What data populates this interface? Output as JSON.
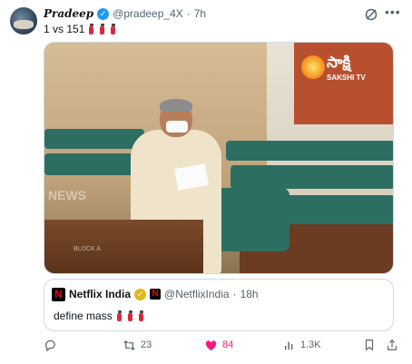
{
  "tweet": {
    "author_name": "Pradeep",
    "author_handle": "@pradeep_4X",
    "separator": "·",
    "time": "7h",
    "text": "1 vs 151",
    "emoji_count": 3
  },
  "media": {
    "channel_logo_text": "సాక్షి",
    "channel_sub": "SAKSHI TV",
    "watermark": "NEWS",
    "block_label": "BLOCK A"
  },
  "quoted": {
    "author_name": "Netflix India",
    "author_handle": "@NetflixIndia",
    "separator": "·",
    "time": "18h",
    "text": "define mass",
    "emoji_count": 3,
    "logo_letter": "N"
  },
  "actions": {
    "replies": "",
    "reposts": "23",
    "likes": "84",
    "views": "1.3K"
  },
  "colors": {
    "accent": "#1d9bf0",
    "like": "#f91880",
    "muted": "#536471",
    "netflix_red": "#e50914",
    "gold_badge": "#e2b719"
  }
}
